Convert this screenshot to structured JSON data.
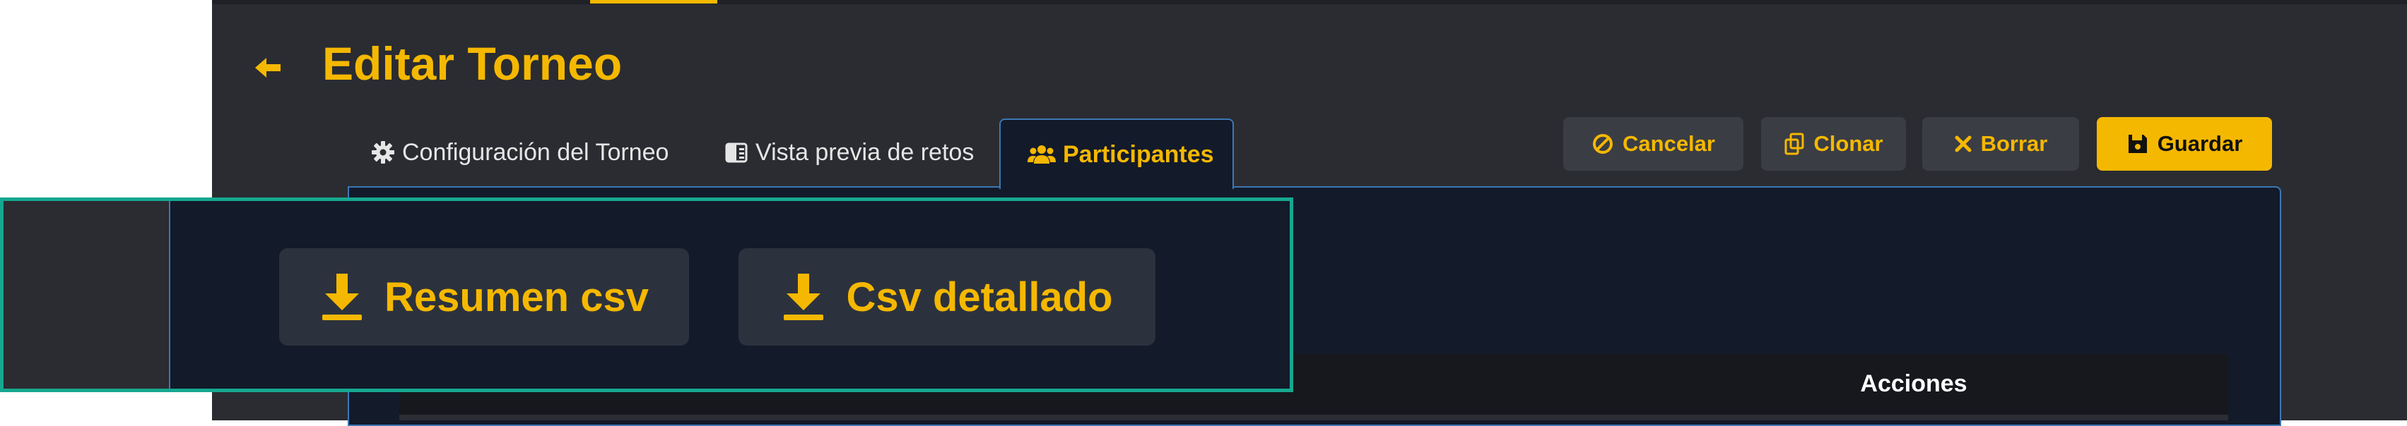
{
  "header": {
    "title": "Editar Torneo"
  },
  "tabs": [
    {
      "label": "Configuración del Torneo",
      "icon": "gear-icon",
      "active": false
    },
    {
      "label": "Vista previa de retos",
      "icon": "preview-icon",
      "active": false
    },
    {
      "label": "Participantes",
      "icon": "users-icon",
      "active": true
    }
  ],
  "actions": {
    "cancel": "Cancelar",
    "clone": "Clonar",
    "delete": "Borrar",
    "save": "Guardar"
  },
  "downloads": {
    "summary": "Resumen csv",
    "detailed": "Csv detallado"
  },
  "table": {
    "columns": [
      "Acciones"
    ]
  },
  "colors": {
    "accent": "#f5b800",
    "panel": "#2a2c31",
    "content": "#131a2a",
    "tab_border": "#3c78b4",
    "highlight": "#16a890"
  }
}
